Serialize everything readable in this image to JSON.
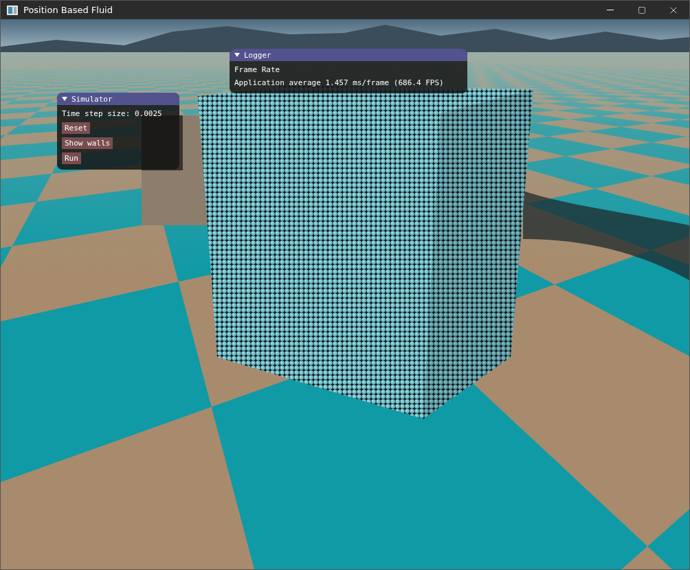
{
  "window": {
    "title": "Position Based Fluid"
  },
  "panels": [
    {
      "title": "Logger",
      "expanded": true,
      "items": [
        {
          "kind": "text",
          "text": "Frame Rate"
        },
        {
          "kind": "text",
          "text": "Application average 1.457 ms/frame (686.4 FPS)"
        }
      ]
    },
    {
      "title": "Simulator",
      "expanded": true,
      "items": [
        {
          "kind": "text",
          "text": "Time step size: 0.0025"
        },
        {
          "kind": "button",
          "text": "Reset"
        },
        {
          "kind": "button",
          "text": "Show walls"
        },
        {
          "kind": "button",
          "text": "Run"
        }
      ]
    }
  ]
}
